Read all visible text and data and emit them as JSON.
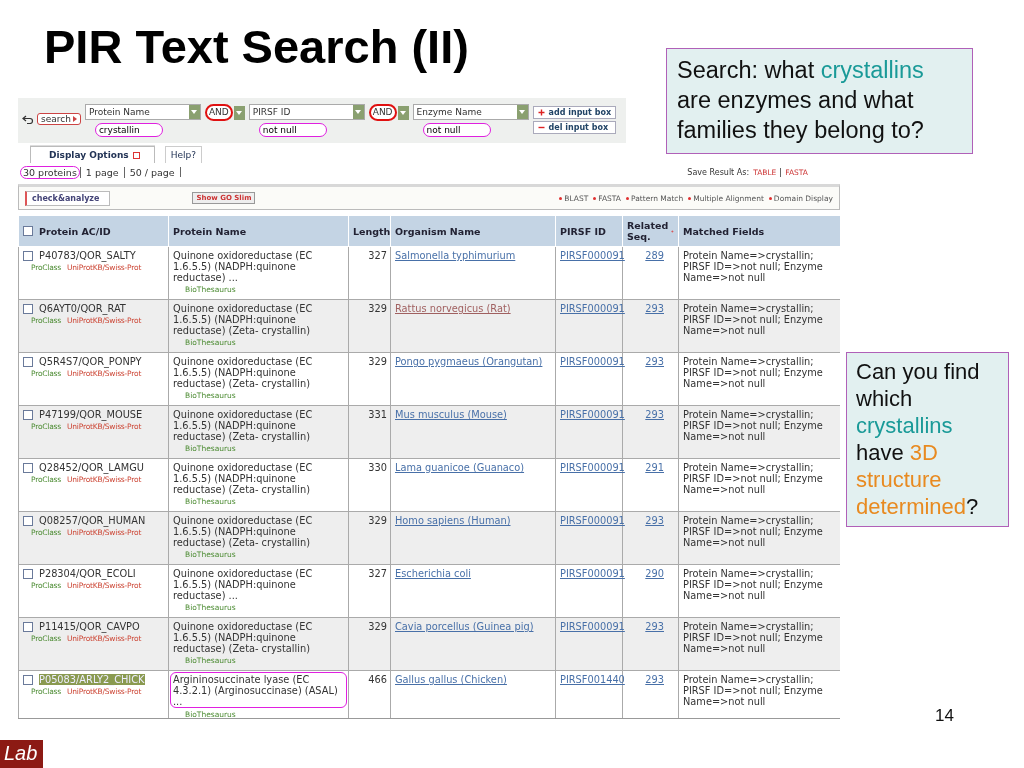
{
  "slide": {
    "title": "PIR Text Search (II)",
    "page_number": "14",
    "footer_label": "Lab"
  },
  "search_form": {
    "search_button": "search",
    "fields": [
      {
        "column": "Protein Name",
        "value": "crystallin",
        "circled": true
      },
      {
        "column": "PIRSF ID",
        "value": "not null",
        "circled": true
      },
      {
        "column": "Enzyme Name",
        "value": "not null",
        "circled": true
      }
    ],
    "operators": [
      {
        "label": "AND",
        "circled": true
      },
      {
        "label": "AND",
        "circled": true
      }
    ],
    "buttons": [
      {
        "kind": "add",
        "label": "add input box"
      },
      {
        "kind": "remove",
        "label": "del input box"
      }
    ]
  },
  "tabs": [
    {
      "label": "Display Options",
      "selected": true
    },
    {
      "label": "Help?",
      "selected": false
    }
  ],
  "results_bar": {
    "count": "30 proteins",
    "count_circled": true,
    "pages": "1 page",
    "per_page": "50 / page",
    "save_label": "Save Result As:",
    "save_formats": [
      "TABLE",
      "FASTA"
    ]
  },
  "toolbar": {
    "analyze_button": "check&analyze",
    "go_button": "Show GO Slim",
    "tools": [
      "BLAST",
      "FASTA",
      "Pattern Match",
      "Multiple Alignment",
      "Domain Display"
    ]
  },
  "table": {
    "header_checked": false,
    "columns": [
      "Protein AC/ID",
      "Protein Name",
      "Length",
      "Organism Name",
      "PIRSF ID",
      "Related Seq.",
      "Matched Fields"
    ],
    "rows": [
      {
        "accession": "P40783/QOR_SALTY",
        "links": [
          "ProClass",
          "UniProtKB/Swiss-Prot"
        ],
        "protein_name": "Quinone oxidoreductase (EC 1.6.5.5) (NADPH:quinone reductase) ...",
        "thesaurus": "BioThesaurus",
        "length": "327",
        "organism": "Salmonella typhimurium",
        "pirsf": "PIRSF000091",
        "related": "289",
        "matched": "Protein Name=>crystallin; PIRSF ID=>not null; Enzyme Name=>not null",
        "checked": false,
        "highlighted": false,
        "visited": false,
        "circled": false
      },
      {
        "accession": "Q6AYT0/QOR_RAT",
        "links": [
          "ProClass",
          "UniProtKB/Swiss-Prot"
        ],
        "protein_name": "Quinone oxidoreductase (EC 1.6.5.5) (NADPH:quinone reductase) (Zeta- crystallin)",
        "thesaurus": "BioThesaurus",
        "length": "329",
        "organism": "Rattus norvegicus (Rat)",
        "pirsf": "PIRSF000091",
        "related": "293",
        "matched": "Protein Name=>crystallin; PIRSF ID=>not null; Enzyme Name=>not null",
        "checked": false,
        "highlighted": false,
        "visited": true,
        "circled": false
      },
      {
        "accession": "Q5R4S7/QOR_PONPY",
        "links": [
          "ProClass",
          "UniProtKB/Swiss-Prot"
        ],
        "protein_name": "Quinone oxidoreductase (EC 1.6.5.5) (NADPH:quinone reductase) (Zeta- crystallin)",
        "thesaurus": "BioThesaurus",
        "length": "329",
        "organism": "Pongo pygmaeus (Orangutan)",
        "pirsf": "PIRSF000091",
        "related": "293",
        "matched": "Protein Name=>crystallin; PIRSF ID=>not null; Enzyme Name=>not null",
        "checked": false,
        "highlighted": false,
        "visited": false,
        "circled": false
      },
      {
        "accession": "P47199/QOR_MOUSE",
        "links": [
          "ProClass",
          "UniProtKB/Swiss-Prot"
        ],
        "protein_name": "Quinone oxidoreductase (EC 1.6.5.5) (NADPH:quinone reductase) (Zeta- crystallin)",
        "thesaurus": "BioThesaurus",
        "length": "331",
        "organism": "Mus musculus (Mouse)",
        "pirsf": "PIRSF000091",
        "related": "293",
        "matched": "Protein Name=>crystallin; PIRSF ID=>not null; Enzyme Name=>not null",
        "checked": false,
        "highlighted": false,
        "visited": false,
        "circled": false
      },
      {
        "accession": "Q28452/QOR_LAMGU",
        "links": [
          "ProClass",
          "UniProtKB/Swiss-Prot"
        ],
        "protein_name": "Quinone oxidoreductase (EC 1.6.5.5) (NADPH:quinone reductase) (Zeta- crystallin)",
        "thesaurus": "BioThesaurus",
        "length": "330",
        "organism": "Lama guanicoe (Guanaco)",
        "pirsf": "PIRSF000091",
        "related": "291",
        "matched": "Protein Name=>crystallin; PIRSF ID=>not null; Enzyme Name=>not null",
        "checked": false,
        "highlighted": false,
        "visited": false,
        "circled": false
      },
      {
        "accession": "Q08257/QOR_HUMAN",
        "links": [
          "ProClass",
          "UniProtKB/Swiss-Prot"
        ],
        "protein_name": "Quinone oxidoreductase (EC 1.6.5.5) (NADPH:quinone reductase) (Zeta- crystallin)",
        "thesaurus": "BioThesaurus",
        "length": "329",
        "organism": "Homo sapiens (Human)",
        "pirsf": "PIRSF000091",
        "related": "293",
        "matched": "Protein Name=>crystallin; PIRSF ID=>not null; Enzyme Name=>not null",
        "checked": false,
        "highlighted": false,
        "visited": false,
        "circled": false
      },
      {
        "accession": "P28304/QOR_ECOLI",
        "links": [
          "ProClass",
          "UniProtKB/Swiss-Prot"
        ],
        "protein_name": "Quinone oxidoreductase (EC 1.6.5.5) (NADPH:quinone reductase) ...",
        "thesaurus": "BioThesaurus",
        "length": "327",
        "organism": "Escherichia coli",
        "pirsf": "PIRSF000091",
        "related": "290",
        "matched": "Protein Name=>crystallin; PIRSF ID=>not null; Enzyme Name=>not null",
        "checked": false,
        "highlighted": false,
        "visited": false,
        "circled": false
      },
      {
        "accession": "P11415/QOR_CAVPO",
        "links": [
          "ProClass",
          "UniProtKB/Swiss-Prot"
        ],
        "protein_name": "Quinone oxidoreductase (EC 1.6.5.5) (NADPH:quinone reductase) (Zeta- crystallin)",
        "thesaurus": "BioThesaurus",
        "length": "329",
        "organism": "Cavia porcellus (Guinea pig)",
        "pirsf": "PIRSF000091",
        "related": "293",
        "matched": "Protein Name=>crystallin; PIRSF ID=>not null; Enzyme Name=>not null",
        "checked": false,
        "highlighted": false,
        "visited": false,
        "circled": false
      },
      {
        "accession": "P05083/ARLY2_CHICK",
        "links": [
          "ProClass",
          "UniProtKB/Swiss-Prot"
        ],
        "protein_name": "Argininosuccinate lyase (EC 4.3.2.1) (Arginosuccinase) (ASAL) ...",
        "thesaurus": "BioThesaurus",
        "length": "466",
        "organism": "Gallus gallus (Chicken)",
        "pirsf": "PIRSF001440",
        "related": "293",
        "matched": "Protein Name=>crystallin; PIRSF ID=>not null; Enzyme Name=>not null",
        "checked": false,
        "highlighted": true,
        "visited": false,
        "circled": true
      }
    ]
  },
  "callouts": [
    {
      "kind": "top",
      "segments": [
        {
          "kind": "plain",
          "text": "Search: what "
        },
        {
          "kind": "term",
          "text": "crystallins"
        },
        {
          "kind": "plain",
          "text": " are enzymes and what families they belong to?"
        }
      ]
    },
    {
      "kind": "side",
      "segments": [
        {
          "kind": "plain",
          "text": "Can you find which "
        },
        {
          "kind": "term",
          "text": "crystallins"
        },
        {
          "kind": "plain",
          "text": " have "
        },
        {
          "kind": "accent",
          "text": "3D structure determined"
        },
        {
          "kind": "plain",
          "text": "?"
        }
      ]
    }
  ]
}
